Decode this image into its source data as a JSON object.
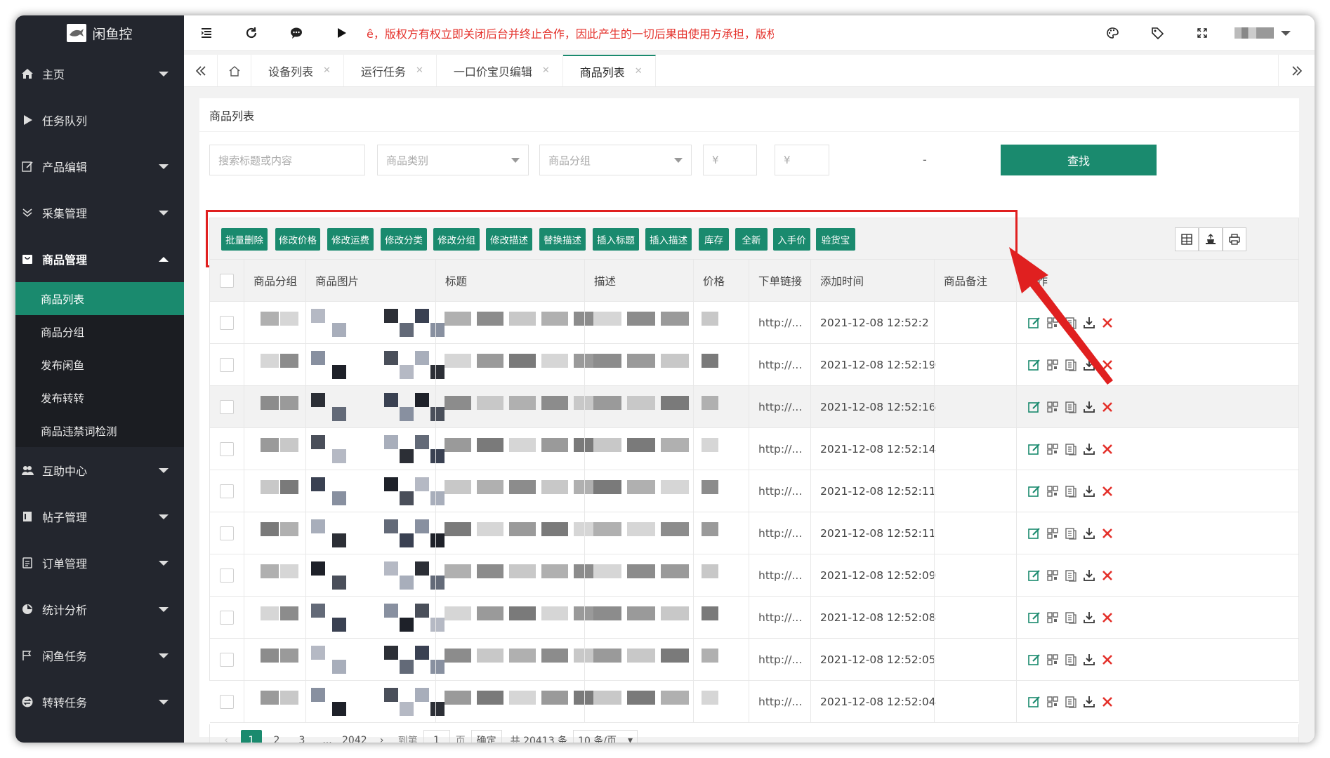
{
  "app": {
    "logo_text": "闲鱼控",
    "accent": "#1a8a6e",
    "alert_color": "#e4312b",
    "highlight_color": "#e02020"
  },
  "sidebar": {
    "items": [
      {
        "label": "主页",
        "icon": "home-icon",
        "caret": "down"
      },
      {
        "label": "任务队列",
        "icon": "play-icon",
        "caret": ""
      },
      {
        "label": "产品编辑",
        "icon": "edit-icon",
        "caret": "down"
      },
      {
        "label": "采集管理",
        "icon": "collect-icon",
        "caret": "down"
      },
      {
        "label": "商品管理",
        "icon": "product-icon",
        "caret": "up"
      }
    ],
    "sub_items": [
      {
        "label": "商品列表",
        "active": true
      },
      {
        "label": "商品分组",
        "active": false
      },
      {
        "label": "发布闲鱼",
        "active": false
      },
      {
        "label": "发布转转",
        "active": false
      },
      {
        "label": "商品违禁词检测",
        "active": false
      }
    ],
    "items_after": [
      {
        "label": "互助中心",
        "icon": "users-icon"
      },
      {
        "label": "帖子管理",
        "icon": "post-icon"
      },
      {
        "label": "订单管理",
        "icon": "order-icon"
      },
      {
        "label": "统计分析",
        "icon": "chart-icon"
      },
      {
        "label": "闲鱼任务",
        "icon": "task-icon"
      },
      {
        "label": "转转任务",
        "icon": "transfer-icon"
      }
    ]
  },
  "topbar": {
    "marquee": "ê，版权方有权立即关闭后台并终止合作，因此产生的一切后果由使用方承担，版权",
    "icons": [
      "menu-icon",
      "refresh-icon",
      "chat-icon",
      "play-icon",
      "palette-icon",
      "tag-icon",
      "fullscreen-icon"
    ]
  },
  "tabs": [
    {
      "label": "设备列表",
      "active": false
    },
    {
      "label": "运行任务",
      "active": false
    },
    {
      "label": "一口价宝贝编辑",
      "active": false
    },
    {
      "label": "商品列表",
      "active": true
    }
  ],
  "page": {
    "title": "商品列表"
  },
  "search": {
    "keyword_placeholder": "搜索标题或内容",
    "category_placeholder": "商品类别",
    "group_placeholder": "商品分组",
    "price_min_placeholder": "¥",
    "price_max_placeholder": "¥",
    "dash": "-",
    "search_label": "查找"
  },
  "toolbar": {
    "buttons": [
      "批量删除",
      "修改价格",
      "修改运费",
      "修改分类",
      "修改分组",
      "修改描述",
      "替换描述",
      "插入标题",
      "插入描述",
      "库存",
      "全新",
      "入手价",
      "验货宝"
    ],
    "icons": [
      "columns-icon",
      "export-icon",
      "print-icon"
    ]
  },
  "table": {
    "columns": [
      "商品分组",
      "商品图片",
      "标题",
      "描述",
      "价格",
      "下单链接",
      "添加时间",
      "商品备注",
      "操作"
    ],
    "rows": [
      {
        "link": "http://...",
        "time": "2021-12-08 12:52:2",
        "highlight": false
      },
      {
        "link": "http://...",
        "time": "2021-12-08 12:52:19",
        "highlight": false
      },
      {
        "link": "http://...",
        "time": "2021-12-08 12:52:16",
        "highlight": true
      },
      {
        "link": "http://...",
        "time": "2021-12-08 12:52:14",
        "highlight": false
      },
      {
        "link": "http://...",
        "time": "2021-12-08 12:52:11",
        "highlight": false
      },
      {
        "link": "http://...",
        "time": "2021-12-08 12:52:11",
        "highlight": false
      },
      {
        "link": "http://...",
        "time": "2021-12-08 12:52:09",
        "highlight": false
      },
      {
        "link": "http://...",
        "time": "2021-12-08 12:52:08",
        "highlight": false
      },
      {
        "link": "http://...",
        "time": "2021-12-08 12:52:05",
        "highlight": false
      },
      {
        "link": "http://...",
        "time": "2021-12-08 12:52:04",
        "highlight": false
      }
    ],
    "row_ops": [
      "edit-icon",
      "qrcode-icon",
      "copy-icon",
      "download-icon",
      "delete-icon"
    ]
  },
  "pager": {
    "pages": [
      "1",
      "2",
      "3"
    ],
    "ellipsis": "...",
    "last_page": "2042",
    "goto_label": "到第",
    "goto_value": "1",
    "page_unit": "页",
    "confirm_label": "确定",
    "total_text": "共 20413 条",
    "page_size": "10 条/页",
    "current_page": 1
  }
}
